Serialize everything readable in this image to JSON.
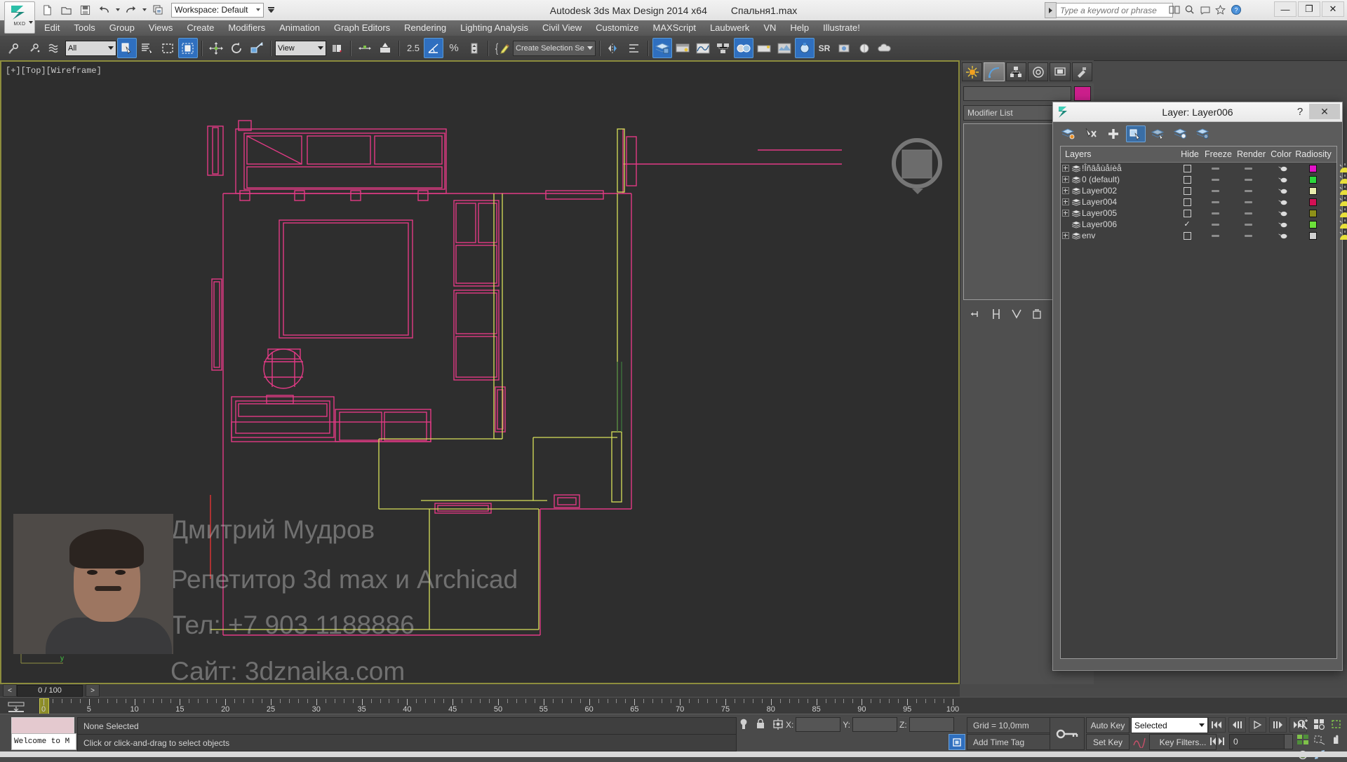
{
  "app": {
    "title": "Autodesk 3ds Max Design 2014 x64",
    "document": "Спальня1.max",
    "app_button_label": "MXD",
    "workspace_label": "Workspace: Default",
    "search_placeholder": "Type a keyword or phrase",
    "window_controls": {
      "minimize": "—",
      "maximize": "❐",
      "close": "✕"
    }
  },
  "menu": {
    "items": [
      "Edit",
      "Tools",
      "Group",
      "Views",
      "Create",
      "Modifiers",
      "Animation",
      "Graph Editors",
      "Rendering",
      "Lighting Analysis",
      "Civil View",
      "Customize",
      "MAXScript",
      "Laubwerk",
      "VN",
      "Help",
      "Illustrate!"
    ]
  },
  "toolbar": {
    "selection_filter": "All",
    "reference_coord": "View",
    "named_selection_set": "Create Selection Se",
    "angle_snap_value": "2.5",
    "percent_label": "%",
    "sr_label": "SR",
    "buttons": [
      "undo-icon",
      "redo-icon",
      "select-link-icon",
      "unlink-icon",
      "bind-space-warp-icon",
      "select-object-icon",
      "select-by-name-icon",
      "rectangular-selection-region-icon",
      "window-crossing-icon",
      "select-and-move-icon",
      "select-and-rotate-icon",
      "select-and-scale-icon",
      "snaps-toggle-icon",
      "angle-snap-icon",
      "percent-snap-icon",
      "spinner-snap-icon",
      "edit-named-selection-icon",
      "mirror-icon",
      "align-icon",
      "layer-manager-icon",
      "curve-editor-icon",
      "schematic-view-icon",
      "material-editor-icon",
      "render-setup-icon",
      "render-frame-window-icon",
      "render-production-icon"
    ]
  },
  "viewport": {
    "label": "[+][Top][Wireframe]"
  },
  "watermark": {
    "line1": "Дмитрий Мудров",
    "line2": "Репетитор 3d max и Archicad",
    "line3": "Тел: +7 903 1188886",
    "line4": "Сайт: 3dznaika.com"
  },
  "command_panel": {
    "tabs": [
      "create-tab",
      "modify-tab",
      "hierarchy-tab",
      "motion-tab",
      "display-tab",
      "utilities-tab"
    ],
    "object_name": "",
    "object_color": "#cc1f8c",
    "modifier_list_label": "Modifier List"
  },
  "layer_dialog": {
    "title": "Layer: Layer006",
    "help_label": "?",
    "close_label": "✕",
    "toolbar_buttons": [
      "create-new-layer-icon",
      "delete-highlighted-layer-icon",
      "add-selected-objects-icon",
      "select-objects-in-layer-icon",
      "highlight-selected-objects-layer-icon",
      "hide-unhide-layer-icon",
      "freeze-unfreeze-layer-icon"
    ],
    "columns": [
      "Layers",
      "Hide",
      "Freeze",
      "Render",
      "Color",
      "Radiosity"
    ],
    "rows": [
      {
        "name": "!Îñâåùåíèå",
        "expandable": true,
        "current": false,
        "hide": false,
        "freeze": false,
        "render": true,
        "color": "#e312c8"
      },
      {
        "name": "0 (default)",
        "expandable": true,
        "current": false,
        "hide": false,
        "freeze": false,
        "render": true,
        "color": "#2cd83c"
      },
      {
        "name": "Layer002",
        "expandable": true,
        "current": false,
        "hide": false,
        "freeze": false,
        "render": true,
        "color": "#e9edad"
      },
      {
        "name": "Layer004",
        "expandable": true,
        "current": false,
        "hide": false,
        "freeze": false,
        "render": true,
        "color": "#d41055"
      },
      {
        "name": "Layer005",
        "expandable": true,
        "current": false,
        "hide": false,
        "freeze": false,
        "render": true,
        "color": "#8e9019"
      },
      {
        "name": "Layer006",
        "expandable": false,
        "current": true,
        "hide": false,
        "freeze": false,
        "render": true,
        "color": "#6ce03a"
      },
      {
        "name": "env",
        "expandable": true,
        "current": false,
        "hide": false,
        "freeze": false,
        "render": true,
        "color": "#cfcfcf"
      }
    ]
  },
  "timeline": {
    "frame_readout": "0 / 100",
    "prev_label": "<",
    "next_label": ">",
    "tick_labels": [
      "0",
      "5",
      "10",
      "15",
      "20",
      "25",
      "30",
      "35",
      "40",
      "45",
      "50",
      "55",
      "60",
      "65",
      "70",
      "75",
      "80",
      "85",
      "90",
      "95",
      "100"
    ]
  },
  "status": {
    "maxscript_mini_listener": "Welcome to M",
    "selection_status": "None Selected",
    "prompt": "Click or click-and-drag to select objects",
    "coord_x_label": "X:",
    "coord_y_label": "Y:",
    "coord_z_label": "Z:",
    "coord_x_value": "",
    "coord_y_value": "",
    "coord_z_value": "",
    "grid_label": "Grid = 10,0mm",
    "add_time_tag": "Add Time Tag",
    "auto_key": "Auto Key",
    "set_key": "Set Key",
    "key_mode": "Selected",
    "key_filters": "Key Filters...",
    "current_frame": "0"
  }
}
